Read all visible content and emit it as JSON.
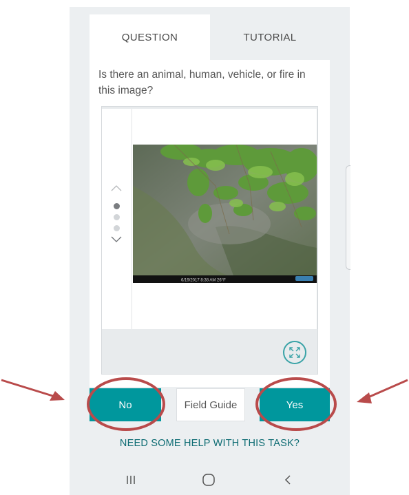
{
  "tabs": [
    {
      "label": "QUESTION",
      "active": true
    },
    {
      "label": "TUTORIAL",
      "active": false
    }
  ],
  "question": "Is there an animal, human, vehicle, or fire in this image?",
  "viewer": {
    "frames_total": 3,
    "current_frame": 1,
    "photo_caption": "6/19/2017   8:38 AM   26°F"
  },
  "buttons": {
    "no": "No",
    "field_guide": "Field Guide",
    "yes": "Yes"
  },
  "help_link": "NEED SOME HELP WITH THIS TASK?",
  "colors": {
    "accent": "#00979d",
    "annotation": "#b94b4b",
    "background": "#eceff1"
  },
  "icons": [
    "chevron-up-icon",
    "chevron-down-icon",
    "expand-icon",
    "recent-apps-icon",
    "home-icon",
    "back-icon"
  ]
}
